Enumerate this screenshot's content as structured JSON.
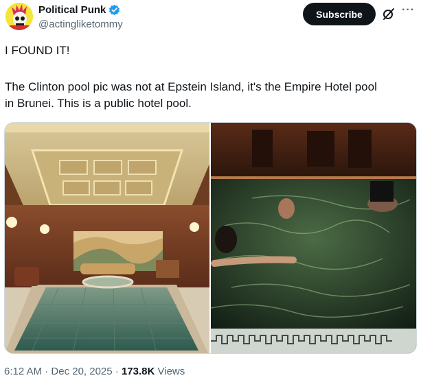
{
  "author": {
    "name": "Political Punk",
    "handle": "@actingliketommy",
    "verified": true,
    "avatar_icon": "punk-skull-avatar-icon"
  },
  "actions": {
    "subscribe_label": "Subscribe",
    "grok_icon": "grok-icon",
    "more_icon": "more-options-icon"
  },
  "post": {
    "line1": "I FOUND IT!",
    "line2": "The Clinton pool pic was not at Epstein Island, it's the Empire Hotel pool",
    "line3": "in Brunei. This is a public hotel pool."
  },
  "media": [
    {
      "name": "hotel-pool-photo",
      "kind": "empty indoor pool with coffered ceiling and mural"
    },
    {
      "name": "night-pool-photo",
      "kind": "dark pool with swimmers"
    }
  ],
  "meta": {
    "time": "6:12 AM",
    "separator": " · ",
    "date": "Dec 20, 2025",
    "views_count": "173.8K",
    "views_label": " Views"
  },
  "colors": {
    "text": "#0f1419",
    "secondary": "#536471",
    "verified": "#1d9bf0",
    "button": "#0f1419"
  }
}
